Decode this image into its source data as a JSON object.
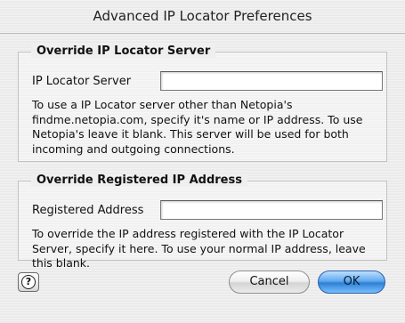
{
  "dialog": {
    "title": "Advanced IP Locator Preferences"
  },
  "server_group": {
    "legend": "Override IP Locator Server",
    "field_label": "IP Locator Server",
    "field_value": "",
    "description": "To use a IP Locator server other than Netopia's findme.netopia.com, specify it's name or IP address.  To use Netopia's leave it blank.  This server will be used for both incoming and outgoing connections."
  },
  "address_group": {
    "legend": "Override Registered IP Address",
    "field_label": "Registered Address",
    "field_value": "",
    "description": "To override the IP address registered with the IP Locator Server, specify it here.  To use your normal IP address, leave this blank."
  },
  "buttons": {
    "help_icon": "?",
    "cancel_label": "Cancel",
    "ok_label": "OK"
  }
}
